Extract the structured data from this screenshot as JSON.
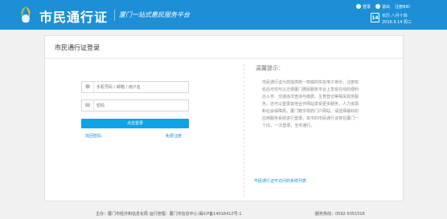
{
  "header": {
    "title": "市民通行证",
    "slogan": "厦门一站式惠民服务平台",
    "links": [
      "登录",
      "退出",
      "注册BID"
    ],
    "calendar_day": "14",
    "lunar_date": "农历 八月十四",
    "date": "2016.9.14  周三"
  },
  "card": {
    "title": "市民通行证登录",
    "username_placeholder": "手机号码 / 邮箱 / 用户名",
    "password_placeholder": "密码",
    "login_label": "点击登录",
    "forgot_label": "找回密码",
    "register_label": "免费注册"
  },
  "tips": {
    "title": "温馨提示：",
    "text": "市民通行证为您提供统一权威的实名电子身份，注册实名后可仅可以方便厦门惠民服务平台上享受在线的便利办入学、交通违法查询与缴费、生育登记等相关政务服务。还可以登录其他合作网站享受更多服务，人力资源和社会保障局，厦门数字政府门户网站。请选择最好的应用服务系统进行登录。本市的市民通行证将在厦门一个ID，一次登录，全市通行。",
    "link": "市民通行证可访问的系统列表"
  },
  "footer": {
    "text": "主办：厦门市经济和信息化局  运行管理：厦门市信息中心  闽ICP备14016412号-1",
    "phone": "服务热线：0592-5051516"
  },
  "colors": {
    "header": "#1c8fd7",
    "button": "#0ea3e6"
  }
}
